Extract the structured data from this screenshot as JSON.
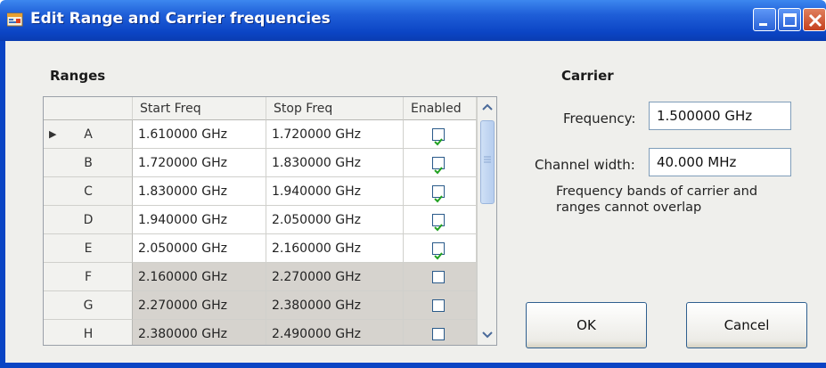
{
  "window": {
    "title": "Edit Range and Carrier frequencies"
  },
  "ranges": {
    "heading": "Ranges",
    "columns": [
      "Start Freq",
      "Stop Freq",
      "Enabled"
    ],
    "rows": [
      {
        "name": "A",
        "start": "1.610000 GHz",
        "stop": "1.720000 GHz",
        "enabled": true
      },
      {
        "name": "B",
        "start": "1.720000 GHz",
        "stop": "1.830000 GHz",
        "enabled": true
      },
      {
        "name": "C",
        "start": "1.830000 GHz",
        "stop": "1.940000 GHz",
        "enabled": true
      },
      {
        "name": "D",
        "start": "1.940000 GHz",
        "stop": "2.050000 GHz",
        "enabled": true
      },
      {
        "name": "E",
        "start": "2.050000 GHz",
        "stop": "2.160000 GHz",
        "enabled": true
      },
      {
        "name": "F",
        "start": "2.160000 GHz",
        "stop": "2.270000 GHz",
        "enabled": false
      },
      {
        "name": "G",
        "start": "2.270000 GHz",
        "stop": "2.380000 GHz",
        "enabled": false
      },
      {
        "name": "H",
        "start": "2.380000 GHz",
        "stop": "2.490000 GHz",
        "enabled": false
      }
    ],
    "current_row_marker": "▶"
  },
  "carrier": {
    "heading": "Carrier",
    "frequency_label": "Frequency:",
    "frequency_value": "1.500000 GHz",
    "channel_width_label": "Channel width:",
    "channel_width_value": "40.000 MHz",
    "note": "Frequency bands of carrier and ranges cannot overlap"
  },
  "buttons": {
    "ok": "OK",
    "cancel": "Cancel"
  },
  "colors": {
    "disabled_row": "#d6d3ce",
    "enabled_row": "#ffffff",
    "titlebar": "#0b44c4"
  }
}
